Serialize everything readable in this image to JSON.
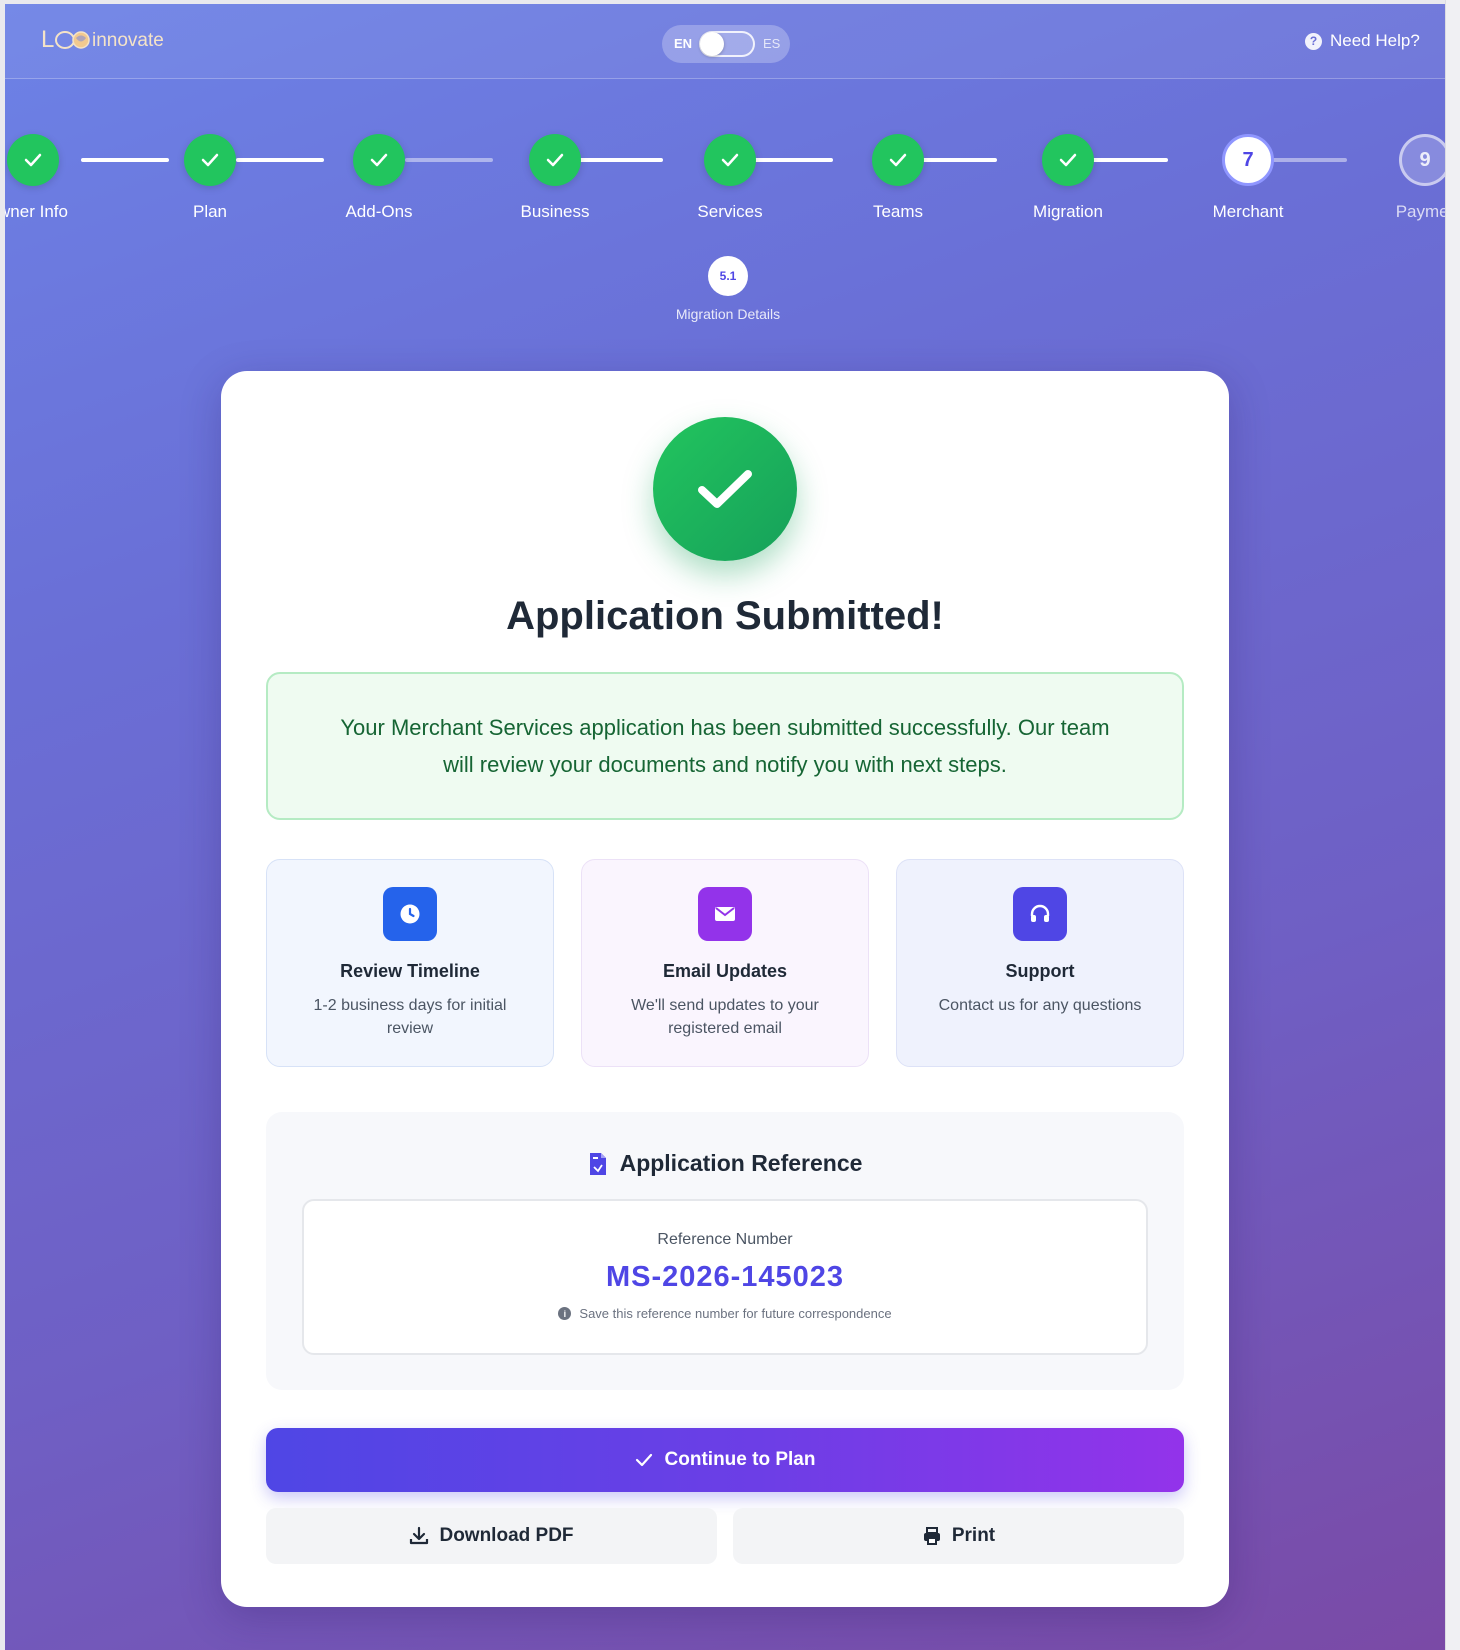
{
  "header": {
    "logo_text": "Leo innovate",
    "lang_left": "EN",
    "lang_right": "ES",
    "help_label": "Need Help?"
  },
  "steps": [
    {
      "label": "wner Info",
      "status": "done"
    },
    {
      "label": "Plan",
      "status": "done"
    },
    {
      "label": "Add-Ons",
      "status": "done"
    },
    {
      "label": "Business",
      "status": "done"
    },
    {
      "label": "Services",
      "status": "done"
    },
    {
      "label": "Teams",
      "status": "done"
    },
    {
      "label": "Migration",
      "status": "done"
    },
    {
      "label": "Merchant",
      "status": "current",
      "number": "7"
    },
    {
      "label": "Paymer",
      "status": "future",
      "number": "9"
    }
  ],
  "substep": {
    "number": "5.1",
    "label": "Migration Details"
  },
  "card": {
    "title": "Application Submitted!",
    "message": "Your Merchant Services application has been submitted successfully. Our team will review your documents and notify you with next steps.",
    "info": [
      {
        "title": "Review Timeline",
        "desc": "1-2 business days for initial review",
        "icon": "clock-icon"
      },
      {
        "title": "Email Updates",
        "desc": "We'll send updates to your registered email",
        "icon": "envelope-icon"
      },
      {
        "title": "Support",
        "desc": "Contact us for any questions",
        "icon": "headset-icon"
      }
    ],
    "reference": {
      "heading": "Application Reference",
      "label": "Reference Number",
      "number": "MS-2026-145023",
      "note": "Save this reference number for future correspondence"
    },
    "buttons": {
      "primary": "Continue to Plan",
      "download": "Download PDF",
      "print": "Print"
    }
  },
  "colors": {
    "done": "#22c55e",
    "accent": "#4f46e5",
    "success_text": "#166534",
    "success_bg": "#effbf1"
  }
}
